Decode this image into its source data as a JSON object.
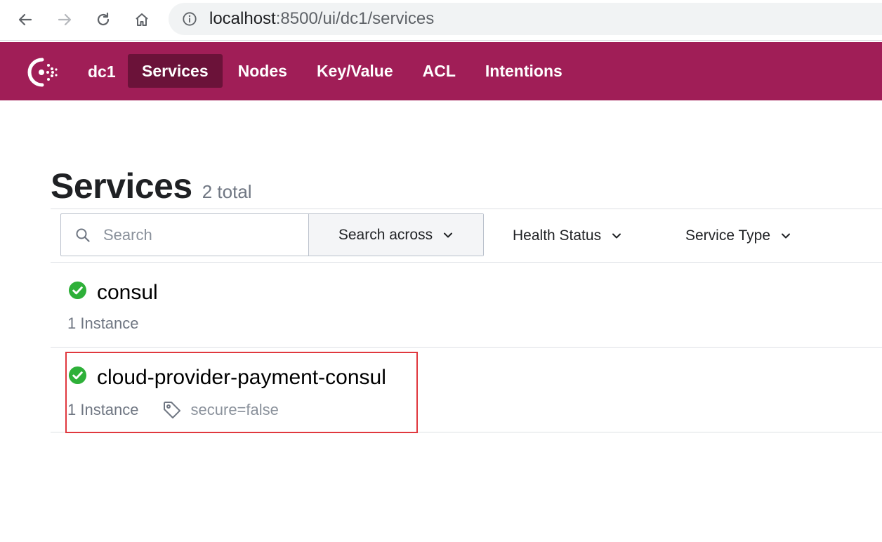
{
  "browser": {
    "url_host": "localhost",
    "url_rest": ":8500/ui/dc1/services"
  },
  "header": {
    "datacenter": "dc1",
    "menu": [
      {
        "label": "Services",
        "active": true
      },
      {
        "label": "Nodes",
        "active": false
      },
      {
        "label": "Key/Value",
        "active": false
      },
      {
        "label": "ACL",
        "active": false
      },
      {
        "label": "Intentions",
        "active": false
      }
    ]
  },
  "page": {
    "title": "Services",
    "count": "2 total"
  },
  "toolbar": {
    "search_placeholder": "Search",
    "search_across_label": "Search across",
    "health_status_label": "Health Status",
    "service_type_label": "Service Type"
  },
  "services": [
    {
      "name": "consul",
      "instances": "1 Instance",
      "tag": "",
      "status": "passing"
    },
    {
      "name": "cloud-provider-payment-consul",
      "instances": "1 Instance",
      "tag": "secure=false",
      "status": "passing"
    }
  ],
  "colors": {
    "brand": "#a01e57",
    "brand_active": "#6b1239",
    "passing": "#2eb039",
    "highlight": "#e0383e"
  }
}
